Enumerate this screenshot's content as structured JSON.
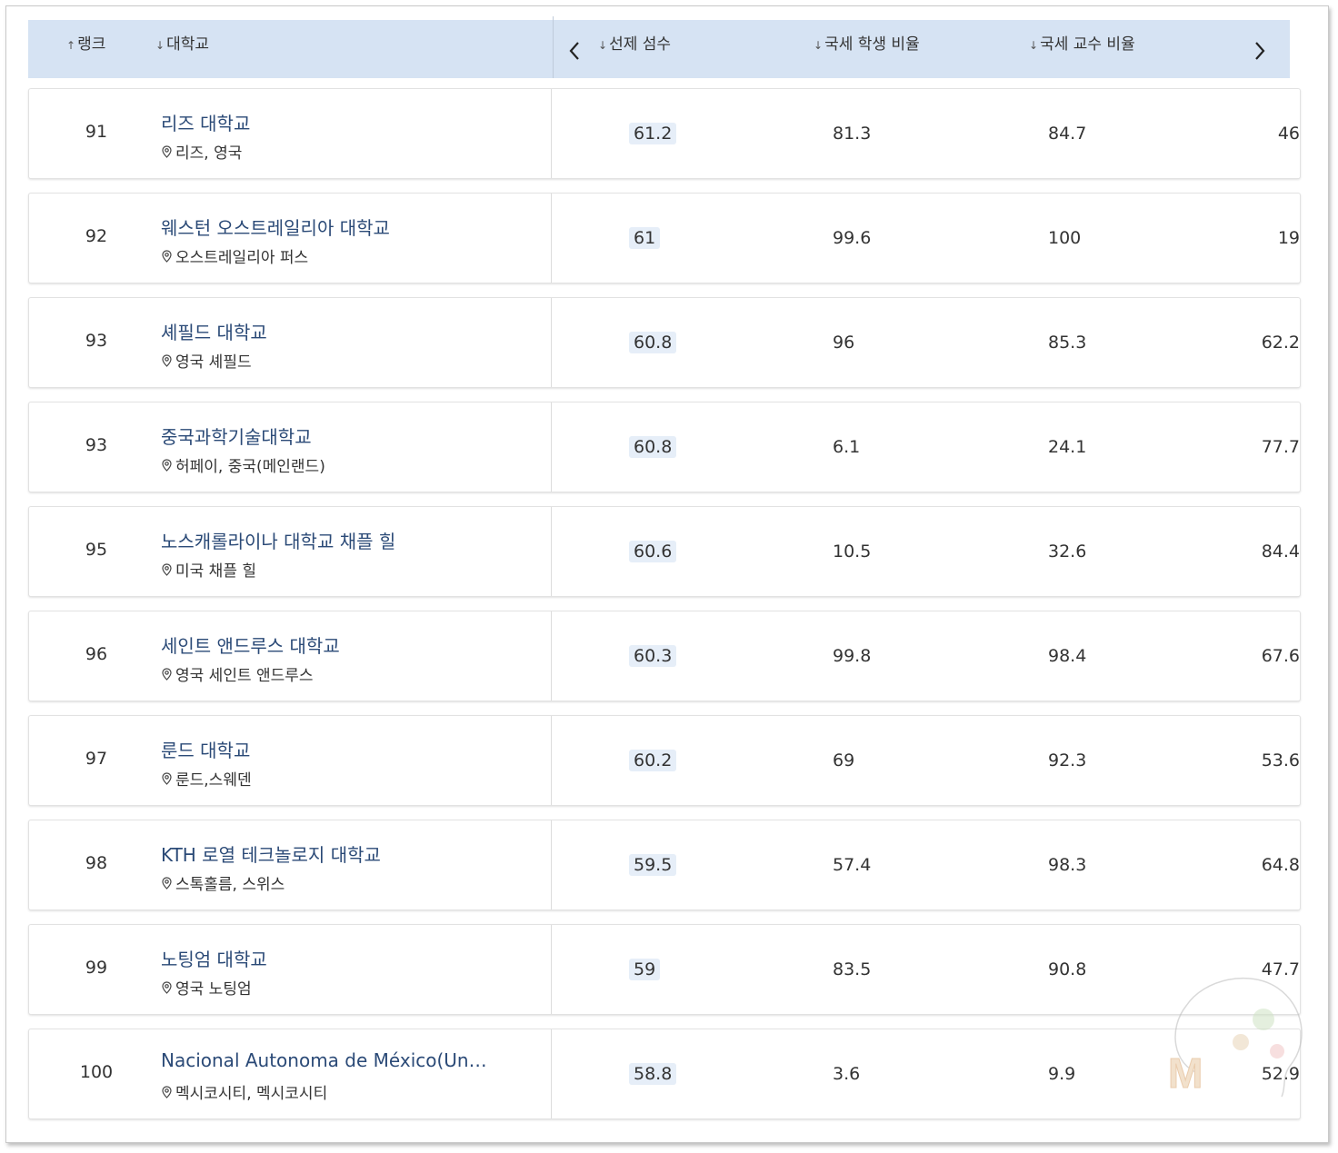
{
  "header": {
    "columns": [
      {
        "arrow": "↑",
        "label": "랭크"
      },
      {
        "arrow": "↓",
        "label": "대학교"
      },
      {
        "arrow": "↓",
        "label": "선제 섬수"
      },
      {
        "arrow": "↓",
        "label": "국세 학생 비율"
      },
      {
        "arrow": "↓",
        "label": "국세 교수 비율"
      }
    ]
  },
  "rows": [
    {
      "rank": "91",
      "name": "리즈 대학교",
      "location": "리즈, 영국",
      "score": "61.2",
      "v1": "81.3",
      "v2": "84.7",
      "v3": "46"
    },
    {
      "rank": "92",
      "name": "웨스턴 오스트레일리아 대학교",
      "location": "오스트레일리아 퍼스",
      "score": "61",
      "v1": "99.6",
      "v2": "100",
      "v3": "19"
    },
    {
      "rank": "93",
      "name": "셰필드 대학교",
      "location": "영국 셰필드",
      "score": "60.8",
      "v1": "96",
      "v2": "85.3",
      "v3": "62.2"
    },
    {
      "rank": "93",
      "name": "중국과학기술대학교",
      "location": "허페이, 중국(메인랜드)",
      "score": "60.8",
      "v1": "6.1",
      "v2": "24.1",
      "v3": "77.7"
    },
    {
      "rank": "95",
      "name": "노스캐롤라이나 대학교 채플 힐",
      "location": "미국 채플 힐",
      "score": "60.6",
      "v1": "10.5",
      "v2": "32.6",
      "v3": "84.4"
    },
    {
      "rank": "96",
      "name": "세인트 앤드루스 대학교",
      "location": "영국 세인트 앤드루스",
      "score": "60.3",
      "v1": "99.8",
      "v2": "98.4",
      "v3": "67.6"
    },
    {
      "rank": "97",
      "name": "룬드 대학교",
      "location": "룬드,스웨덴",
      "score": "60.2",
      "v1": "69",
      "v2": "92.3",
      "v3": "53.6"
    },
    {
      "rank": "98",
      "name": "KTH 로열 테크놀로지 대학교",
      "location": "스톡홀름, 스위스",
      "score": "59.5",
      "v1": "57.4",
      "v2": "98.3",
      "v3": "64.8"
    },
    {
      "rank": "99",
      "name": "노팅엄 대학교",
      "location": "영국 노팅엄",
      "score": "59",
      "v1": "83.5",
      "v2": "90.8",
      "v3": "47.7"
    },
    {
      "rank": "100",
      "name": "Nacional Autonoma de México(Univers…",
      "location": "멕시코시티, 멕시코시티",
      "score": "58.8",
      "v1": "3.6",
      "v2": "9.9",
      "v3": "52.9"
    }
  ]
}
